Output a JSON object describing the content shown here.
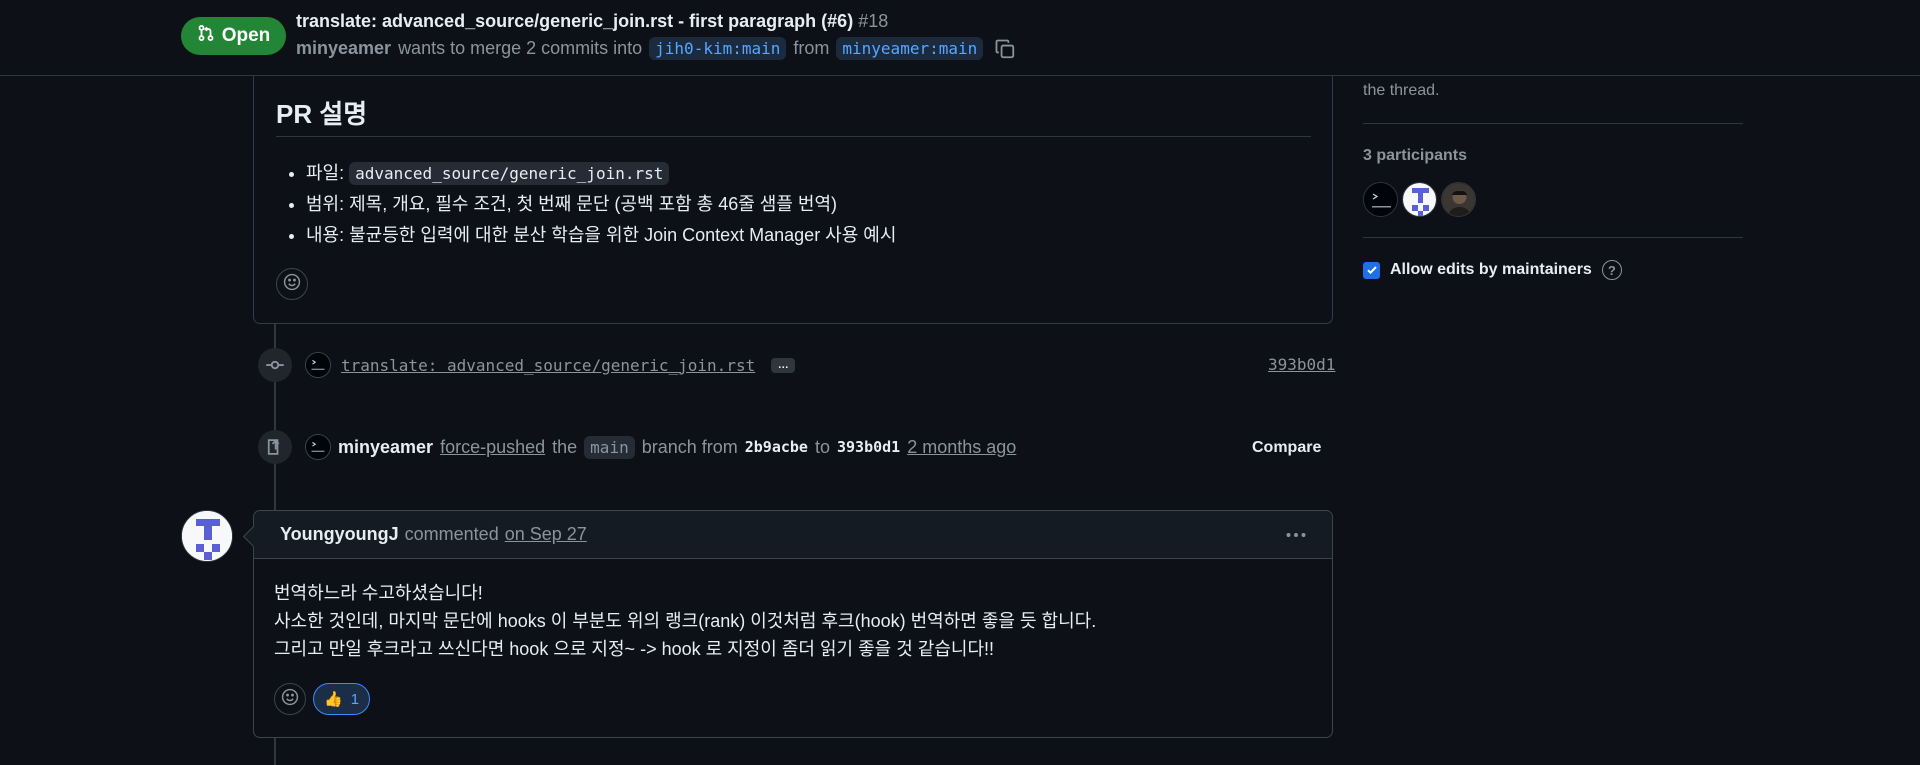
{
  "header": {
    "state": "Open",
    "title": "translate: advanced_source/generic_join.rst - first paragraph (#6)",
    "number": "#18",
    "author": "minyeamer",
    "merge_text": "wants to merge 2 commits into",
    "base_branch": "jih0-kim:main",
    "from_text": "from",
    "head_branch": "minyeamer:main"
  },
  "description": {
    "heading": "PR 설명",
    "items": [
      {
        "label": "파일: ",
        "code": "advanced_source/generic_join.rst"
      },
      {
        "label": "범위: 제목, 개요, 필수 조건, 첫 번째 문단 (공백 포함 총 46줄 샘플 번역)"
      },
      {
        "label": "내용: 불균등한 입력에 대한 분산 학습을 위한 Join Context Manager 사용 예시"
      }
    ]
  },
  "commit": {
    "message": "translate: advanced_source/generic_join.rst",
    "ellipsis": "…",
    "sha": "393b0d1"
  },
  "force_push": {
    "author": "minyeamer",
    "action": "force-pushed",
    "the": "the",
    "branch": "main",
    "branch_from": "branch from",
    "from_sha": "2b9acbe",
    "to": "to",
    "to_sha": "393b0d1",
    "time": "2 months ago",
    "compare_label": "Compare"
  },
  "comment": {
    "author": "YoungyoungJ",
    "action": "commented",
    "date": "on Sep 27",
    "lines": [
      "번역하느라 수고하셨습니다!",
      "사소한 것인데, 마지막 문단에 hooks 이 부분도 위의 랭크(rank) 이것처럼 후크(hook) 번역하면 좋을 듯 합니다.",
      "그리고 만일 후크라고 쓰신다면 hook 으로 지정~ -> hook 로 지정이 좀더 읽기 좋을 것 같습니다!!"
    ],
    "reaction_emoji": "👍",
    "reaction_count": "1"
  },
  "sidebar": {
    "note": "the thread.",
    "participants_title": "3 participants",
    "allow_edits_label": "Allow edits by maintainers",
    "help": "?"
  },
  "colors": {
    "open_green": "#238636",
    "accent_blue": "#58a6ff",
    "background": "#0d1117"
  }
}
